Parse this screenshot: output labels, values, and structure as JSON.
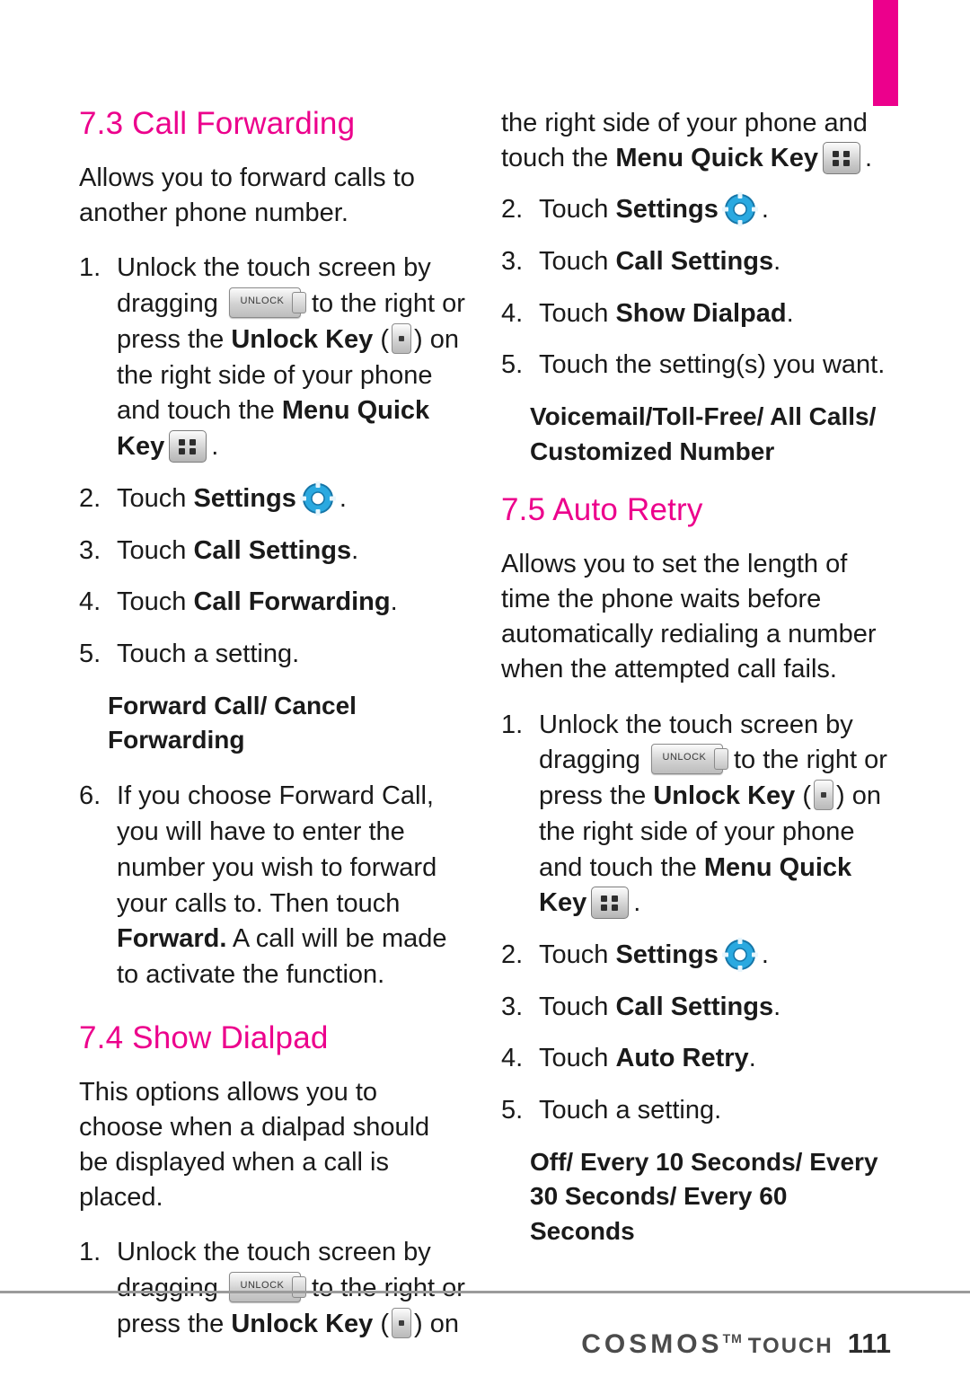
{
  "page": {
    "number": "111",
    "brand": "COSMOS",
    "brand_tm": "TM",
    "brand_sub": "TOUCH"
  },
  "left_column": {
    "section_74_heading": "7.4 Show Dialpad",
    "section_73": {
      "heading": "7.3 Call Forwarding",
      "intro": "Allows you to forward calls to another phone number.",
      "steps": [
        {
          "num": "1.",
          "parts": [
            {
              "type": "text",
              "value": "Unlock the touch screen by dragging "
            },
            {
              "type": "icon",
              "value": "unlock-slider-icon"
            },
            {
              "type": "text",
              "value": " to the right or press the "
            },
            {
              "type": "bold",
              "value": "Unlock Key"
            },
            {
              "type": "text",
              "value": " ("
            },
            {
              "type": "icon",
              "value": "unlock-key-icon"
            },
            {
              "type": "text",
              "value": ") on the right side of your phone and touch the "
            },
            {
              "type": "bold",
              "value": "Menu Quick Key"
            },
            {
              "type": "icon",
              "value": "menu-quick-key-icon"
            },
            {
              "type": "text",
              "value": "."
            }
          ]
        },
        {
          "num": "2.",
          "parts": [
            {
              "type": "text",
              "value": "Touch "
            },
            {
              "type": "bold",
              "value": "Settings"
            },
            {
              "type": "icon",
              "value": "settings-gear-icon"
            },
            {
              "type": "text",
              "value": "."
            }
          ]
        },
        {
          "num": "3.",
          "parts": [
            {
              "type": "text",
              "value": "Touch "
            },
            {
              "type": "bold",
              "value": "Call Settings"
            },
            {
              "type": "text",
              "value": "."
            }
          ]
        },
        {
          "num": "4.",
          "parts": [
            {
              "type": "text",
              "value": "Touch "
            },
            {
              "type": "bold",
              "value": "Call Forwarding"
            },
            {
              "type": "text",
              "value": "."
            }
          ]
        },
        {
          "num": "5.",
          "parts": [
            {
              "type": "text",
              "value": "Touch a setting."
            }
          ]
        }
      ],
      "subhead": "Forward Call/ Cancel Forwarding",
      "step6": {
        "num": "6.",
        "text": "If you choose Forward Call, you will have to enter the number you wish to forward your calls to. Then touch ",
        "bold": "Forward.",
        "text_after": " A call will be made to activate the function."
      }
    },
    "section_74": {
      "heading": "7.4 Show Dialpad",
      "intro": "This options allows you to choose when a dialpad should be displayed when a call is placed.",
      "step1": {
        "num": "1.",
        "text_a": "Unlock the touch screen by dragging ",
        "text_b": " to the right or press the ",
        "bold_unlock": "Unlock Key",
        "text_c": " (",
        "text_d": ") on"
      }
    }
  },
  "right_column": {
    "continuation": {
      "text_a": "the right side of your phone and touch the ",
      "bold": "Menu Quick Key",
      "text_b": "."
    },
    "section_74_steps": [
      {
        "num": "2.",
        "parts": [
          {
            "type": "text",
            "value": "Touch "
          },
          {
            "type": "bold",
            "value": "Settings"
          },
          {
            "type": "icon",
            "value": "settings-gear-icon"
          },
          {
            "type": "text",
            "value": "."
          }
        ]
      },
      {
        "num": "3.",
        "parts": [
          {
            "type": "text",
            "value": "Touch "
          },
          {
            "type": "bold",
            "value": "Call Settings"
          },
          {
            "type": "text",
            "value": "."
          }
        ]
      },
      {
        "num": "4.",
        "parts": [
          {
            "type": "text",
            "value": "Touch "
          },
          {
            "type": "bold",
            "value": "Show Dialpad"
          },
          {
            "type": "text",
            "value": "."
          }
        ]
      },
      {
        "num": "5.",
        "parts": [
          {
            "type": "text",
            "value": "Touch the setting(s) you want."
          }
        ]
      }
    ],
    "section_74_subhead": "Voicemail/Toll-Free/ All Calls/ Customized Number",
    "section_75": {
      "heading": "7.5 Auto Retry",
      "intro": "Allows you to set the length of time the phone waits before automatically redialing a number when the attempted call fails.",
      "steps": [
        {
          "num": "1.",
          "parts": [
            {
              "type": "text",
              "value": "Unlock the touch screen by dragging "
            },
            {
              "type": "icon",
              "value": "unlock-slider-icon"
            },
            {
              "type": "text",
              "value": " to the right or press the "
            },
            {
              "type": "bold",
              "value": "Unlock Key"
            },
            {
              "type": "text",
              "value": " ("
            },
            {
              "type": "icon",
              "value": "unlock-key-icon"
            },
            {
              "type": "text",
              "value": ") on the right side of your phone and touch the "
            },
            {
              "type": "bold",
              "value": "Menu Quick Key"
            },
            {
              "type": "icon",
              "value": "menu-quick-key-icon"
            },
            {
              "type": "text",
              "value": "."
            }
          ]
        },
        {
          "num": "2.",
          "parts": [
            {
              "type": "text",
              "value": "Touch "
            },
            {
              "type": "bold",
              "value": "Settings"
            },
            {
              "type": "icon",
              "value": "settings-gear-icon"
            },
            {
              "type": "text",
              "value": "."
            }
          ]
        },
        {
          "num": "3.",
          "parts": [
            {
              "type": "text",
              "value": "Touch "
            },
            {
              "type": "bold",
              "value": "Call Settings"
            },
            {
              "type": "text",
              "value": "."
            }
          ]
        },
        {
          "num": "4.",
          "parts": [
            {
              "type": "text",
              "value": "Touch "
            },
            {
              "type": "bold",
              "value": "Auto Retry"
            },
            {
              "type": "text",
              "value": "."
            }
          ]
        },
        {
          "num": "5.",
          "parts": [
            {
              "type": "text",
              "value": "Touch a setting."
            }
          ]
        }
      ],
      "subhead": "Off/ Every 10 Seconds/ Every 30 Seconds/ Every 60 Seconds"
    }
  },
  "colors": {
    "accent": "#ec008c",
    "text": "#1a1a1a",
    "rule": "#9b9b9b"
  },
  "labels": {
    "unlock_chip_text": "UNLOCK",
    "step_l1_a": "Unlock the touch screen by dragging ",
    "step_l1_b": " to the right or press the ",
    "step_l1_bold1": "Unlock Key",
    "step_l1_c": " (",
    "step_l1_d": ") on the right side of your phone and touch the ",
    "step_l1_bold2": "Menu Quick Key",
    "step_l1_e": ".",
    "touch": "Touch ",
    "settings": "Settings",
    "period": ".",
    "call_settings": "Call Settings",
    "call_forwarding": "Call Forwarding",
    "show_dialpad": "Show Dialpad",
    "auto_retry": "Auto Retry",
    "touch_a_setting": "Touch a setting.",
    "touch_settings_you_want": "Touch the setting(s) you want."
  }
}
